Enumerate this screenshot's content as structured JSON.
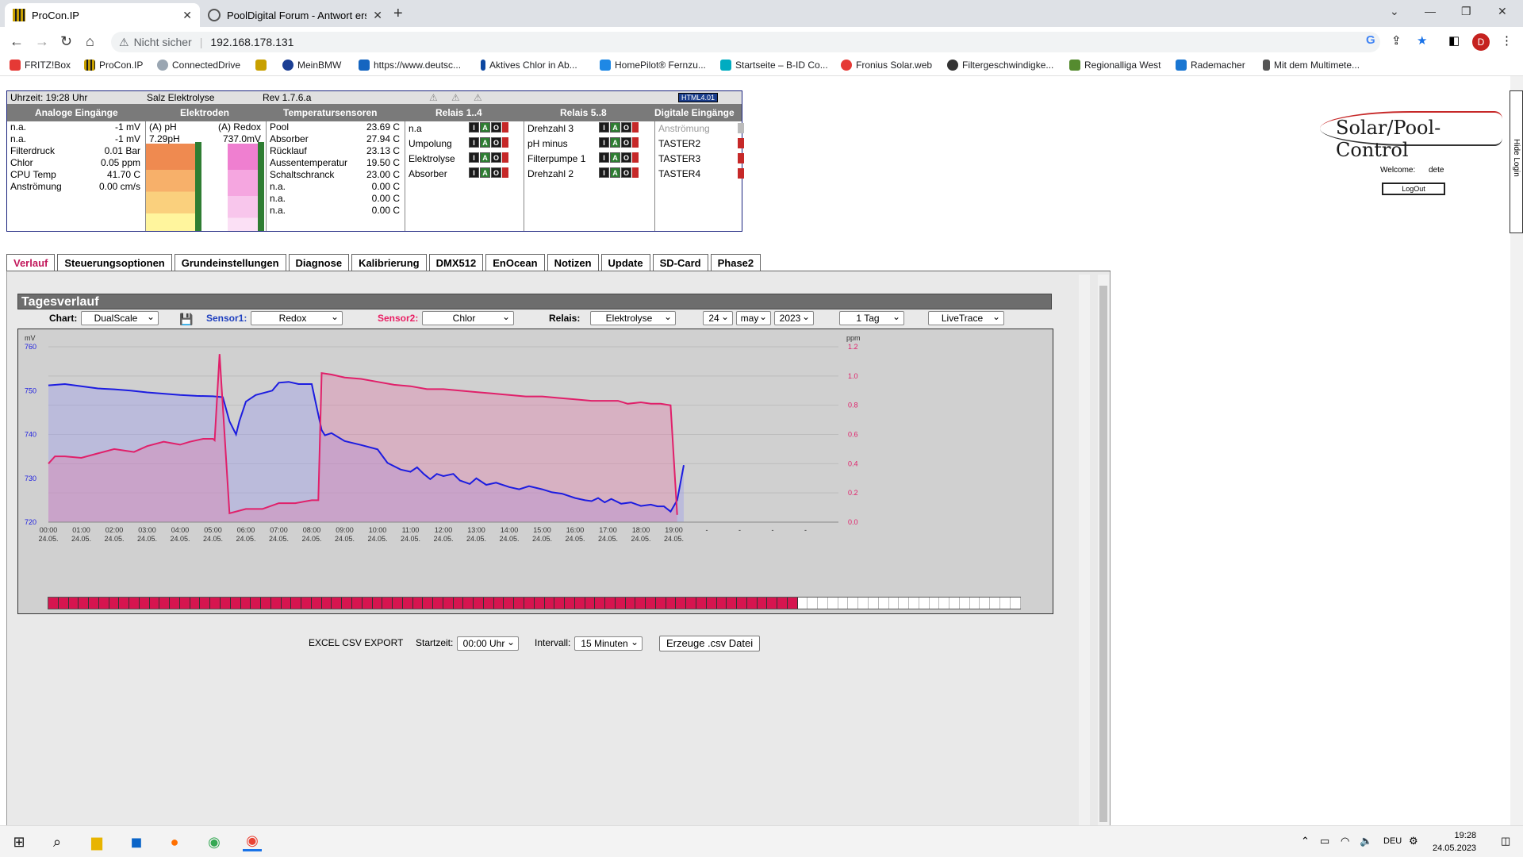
{
  "browser": {
    "tabs": [
      {
        "title": "ProCon.IP",
        "active": true
      },
      {
        "title": "PoolDigital Forum - Antwort erst",
        "active": false
      }
    ],
    "security_label": "Nicht sicher",
    "url": "192.168.178.131",
    "profile_initial": "D",
    "bookmarks": [
      "FRITZ!Box",
      "ProCon.IP",
      "ConnectedDrive",
      "MeinBMW",
      "https://www.deutsc...",
      "Aktives Chlor in Ab...",
      "HomePilot® Fernzu...",
      "Startseite – B-ID Co...",
      "Fronius Solar.web",
      "Filtergeschwindigke...",
      "Regionalliga West",
      "Rademacher",
      "Mit dem Multimete..."
    ]
  },
  "status": {
    "time": "Uhrzeit: 19:28 Uhr",
    "mode": "Salz Elektrolyse",
    "rev": "Rev 1.7.6.a",
    "html_badge": "HTML4.01",
    "columns": [
      "Analoge Eingänge",
      "Elektroden",
      "Temperatursensoren",
      "Relais 1..4",
      "Relais 5..8",
      "Digitale Eingänge"
    ],
    "analog": [
      {
        "name": "n.a.",
        "value": "-1 mV"
      },
      {
        "name": "n.a.",
        "value": "-1 mV"
      },
      {
        "name": "Filterdruck",
        "value": "0.01 Bar"
      },
      {
        "name": "Chlor",
        "value": "0.05 ppm"
      },
      {
        "name": "CPU Temp",
        "value": "41.70 C"
      },
      {
        "name": "Anströmung",
        "value": "0.00 cm/s"
      }
    ],
    "electrodes": {
      "ph_label": "(A) pH",
      "ph_value": "7.29pH",
      "redox_label": "(A) Redox",
      "redox_value": "737.0mV"
    },
    "temps": [
      {
        "name": "Pool",
        "value": "23.69 C"
      },
      {
        "name": "Absorber",
        "value": "27.94 C"
      },
      {
        "name": "Rücklauf",
        "value": "23.13 C"
      },
      {
        "name": "Aussentemperatur",
        "value": "19.50 C"
      },
      {
        "name": "Schaltschranck",
        "value": "23.00 C"
      },
      {
        "name": "n.a.",
        "value": "0.00 C"
      },
      {
        "name": "n.a.",
        "value": "0.00 C"
      },
      {
        "name": "n.a.",
        "value": "0.00 C"
      }
    ],
    "relays1": [
      "n.a",
      "Umpolung",
      "Elektrolyse",
      "Absorber"
    ],
    "relays2": [
      "Drehzahl 3",
      "pH minus",
      "Filterpumpe 1",
      "Drehzahl 2"
    ],
    "digital": [
      "Anströmung",
      "TASTER2",
      "TASTER3",
      "TASTER4"
    ],
    "iao": [
      "I",
      "A",
      "O"
    ]
  },
  "side": {
    "logo": "Solar/Pool-Control",
    "welcome": "Welcome:      dete",
    "logout": "LogOut",
    "hide_login": "Hide Login"
  },
  "tabs": [
    "Verlauf",
    "Steuerungsoptionen",
    "Grundeinstellungen",
    "Diagnose",
    "Kalibrierung",
    "DMX512",
    "EnOcean",
    "Notizen",
    "Update",
    "SD-Card",
    "Phase2"
  ],
  "tagesverlauf": {
    "title": "Tagesverlauf",
    "chart_label": "Chart:",
    "chart_value": "DualScale",
    "sensor1_label": "Sensor1:",
    "sensor1_value": "Redox",
    "sensor2_label": "Sensor2:",
    "sensor2_value": "Chlor",
    "relais_label": "Relais:",
    "relais_value": "Elektrolyse",
    "day": "24",
    "month": "may",
    "year": "2023",
    "range": "1 Tag",
    "mode": "LiveTrace"
  },
  "chart_data": {
    "type": "line",
    "ylabel": "mV",
    "y2label": "ppm",
    "ylim": [
      720,
      760
    ],
    "y2lim": [
      0.0,
      1.2
    ],
    "yticks": [
      "760",
      "750",
      "740",
      "730",
      "720"
    ],
    "y2ticks": [
      "1.2",
      "1.0",
      "0.8",
      "0.6",
      "0.4",
      "0.2",
      "0.0"
    ],
    "xticks": [
      [
        "00:00",
        "24.05."
      ],
      [
        "01:00",
        "24.05."
      ],
      [
        "02:00",
        "24.05."
      ],
      [
        "03:00",
        "24.05."
      ],
      [
        "04:00",
        "24.05."
      ],
      [
        "05:00",
        "24.05."
      ],
      [
        "06:00",
        "24.05."
      ],
      [
        "07:00",
        "24.05."
      ],
      [
        "08:00",
        "24.05."
      ],
      [
        "09:00",
        "24.05."
      ],
      [
        "10:00",
        "24.05."
      ],
      [
        "11:00",
        "24.05."
      ],
      [
        "12:00",
        "24.05."
      ],
      [
        "13:00",
        "24.05."
      ],
      [
        "14:00",
        "24.05."
      ],
      [
        "15:00",
        "24.05."
      ],
      [
        "16:00",
        "24.05."
      ],
      [
        "17:00",
        "24.05."
      ],
      [
        "18:00",
        "24.05."
      ],
      [
        "19:00",
        "24.05."
      ],
      [
        "-",
        ""
      ],
      [
        "-",
        ""
      ],
      [
        "-",
        ""
      ],
      [
        "-",
        ""
      ]
    ],
    "series": [
      {
        "axis": "left",
        "color": "#1c1ce0",
        "points": [
          [
            0,
            751.2
          ],
          [
            0.5,
            751.5
          ],
          [
            1,
            751
          ],
          [
            1.5,
            750.5
          ],
          [
            2,
            750.3
          ],
          [
            2.5,
            750
          ],
          [
            3,
            749.6
          ],
          [
            3.5,
            749.3
          ],
          [
            4,
            749
          ],
          [
            4.5,
            748.8
          ],
          [
            5,
            748.7
          ],
          [
            5.3,
            748.5
          ],
          [
            5.5,
            743
          ],
          [
            5.7,
            740
          ],
          [
            5.8,
            743
          ],
          [
            6,
            747.5
          ],
          [
            6.3,
            749
          ],
          [
            6.8,
            750
          ],
          [
            7,
            751.8
          ],
          [
            7.3,
            752
          ],
          [
            7.6,
            751.5
          ],
          [
            8,
            751.5
          ],
          [
            8.1,
            748
          ],
          [
            8.3,
            741
          ],
          [
            8.4,
            739.8
          ],
          [
            8.6,
            740.3
          ],
          [
            9,
            738.5
          ],
          [
            9.5,
            737.6
          ],
          [
            10,
            736.6
          ],
          [
            10.3,
            733.5
          ],
          [
            10.7,
            732
          ],
          [
            11,
            731.5
          ],
          [
            11.2,
            732.5
          ],
          [
            11.4,
            731
          ],
          [
            11.6,
            729.8
          ],
          [
            11.8,
            731
          ],
          [
            12,
            730.5
          ],
          [
            12.3,
            731
          ],
          [
            12.5,
            729.5
          ],
          [
            12.8,
            728.7
          ],
          [
            13,
            730
          ],
          [
            13.3,
            728.5
          ],
          [
            13.6,
            729
          ],
          [
            14,
            728
          ],
          [
            14.3,
            727.5
          ],
          [
            14.6,
            728.2
          ],
          [
            15,
            727.5
          ],
          [
            15.3,
            726.8
          ],
          [
            15.6,
            726.5
          ],
          [
            16,
            725.5
          ],
          [
            16.3,
            725
          ],
          [
            16.5,
            724.8
          ],
          [
            16.7,
            725.5
          ],
          [
            16.9,
            724.5
          ],
          [
            17.1,
            725.3
          ],
          [
            17.4,
            724.2
          ],
          [
            17.7,
            724.5
          ],
          [
            18,
            723.7
          ],
          [
            18.3,
            724
          ],
          [
            18.5,
            723.6
          ],
          [
            18.7,
            723.6
          ],
          [
            18.9,
            722.4
          ],
          [
            19.1,
            725
          ],
          [
            19.3,
            733
          ]
        ]
      },
      {
        "axis": "right",
        "color": "#e0206a",
        "points": [
          [
            0,
            0.4
          ],
          [
            0.2,
            0.45
          ],
          [
            0.5,
            0.45
          ],
          [
            1,
            0.44
          ],
          [
            1.5,
            0.47
          ],
          [
            2,
            0.5
          ],
          [
            2.3,
            0.49
          ],
          [
            2.6,
            0.48
          ],
          [
            3,
            0.52
          ],
          [
            3.5,
            0.55
          ],
          [
            4,
            0.53
          ],
          [
            4.3,
            0.55
          ],
          [
            4.7,
            0.57
          ],
          [
            5,
            0.57
          ],
          [
            5.05,
            0.56
          ],
          [
            5.2,
            1.15
          ],
          [
            5.5,
            0.06
          ],
          [
            6,
            0.09
          ],
          [
            6.5,
            0.09
          ],
          [
            7,
            0.13
          ],
          [
            7.5,
            0.13
          ],
          [
            8,
            0.15
          ],
          [
            8.2,
            0.15
          ],
          [
            8.3,
            1.02
          ],
          [
            8.6,
            1.01
          ],
          [
            9,
            0.99
          ],
          [
            9.5,
            0.98
          ],
          [
            10,
            0.96
          ],
          [
            10.5,
            0.94
          ],
          [
            11,
            0.93
          ],
          [
            11.5,
            0.91
          ],
          [
            12,
            0.91
          ],
          [
            12.5,
            0.9
          ],
          [
            13,
            0.89
          ],
          [
            13.5,
            0.88
          ],
          [
            14,
            0.87
          ],
          [
            14.5,
            0.86
          ],
          [
            15,
            0.86
          ],
          [
            15.5,
            0.85
          ],
          [
            16,
            0.84
          ],
          [
            16.5,
            0.83
          ],
          [
            17,
            0.83
          ],
          [
            17.3,
            0.83
          ],
          [
            17.6,
            0.81
          ],
          [
            18,
            0.82
          ],
          [
            18.3,
            0.81
          ],
          [
            18.6,
            0.81
          ],
          [
            18.9,
            0.8
          ],
          [
            19.1,
            0.05
          ]
        ]
      }
    ],
    "progress_filled": 0.774
  },
  "csv": {
    "label": "EXCEL CSV EXPORT",
    "start_label": "Startzeit:",
    "start_value": "00:00 Uhr",
    "interval_label": "Intervall:",
    "interval_value": "15 Minuten",
    "button": "Erzeuge .csv Datei"
  },
  "taskbar": {
    "lang": "DEU",
    "time": "19:28",
    "date": "24.05.2023"
  }
}
